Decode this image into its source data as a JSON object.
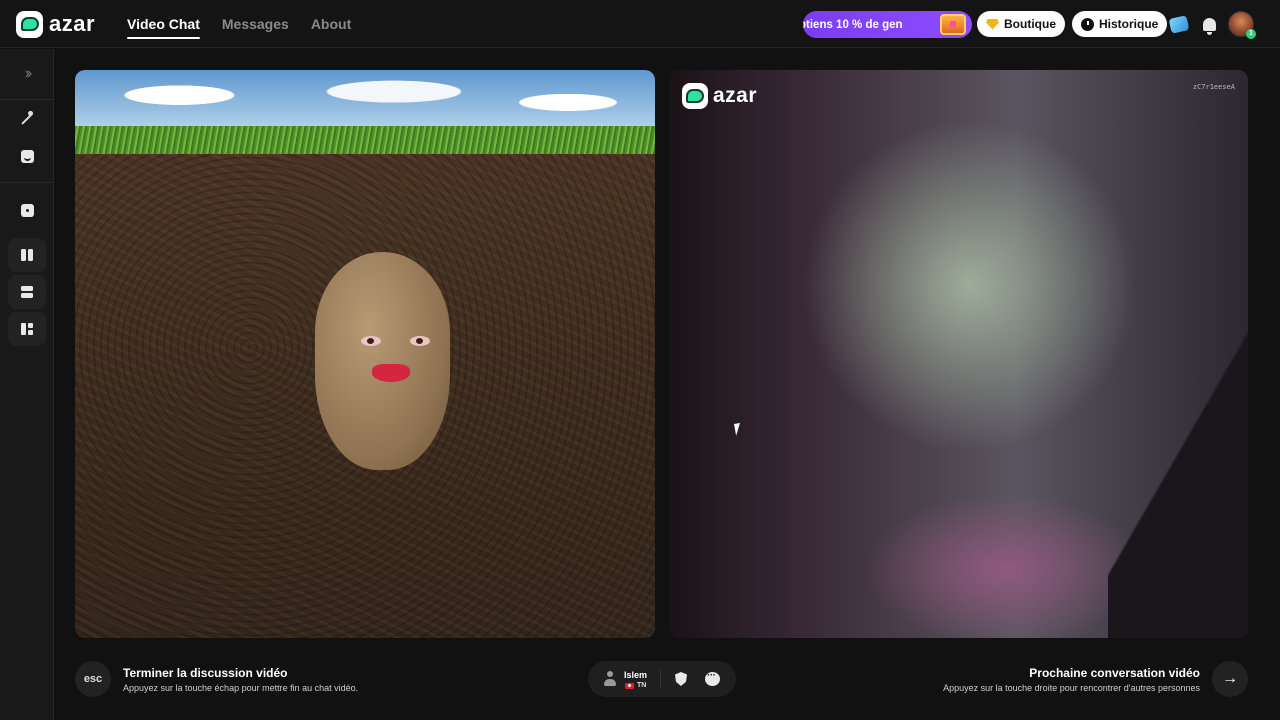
{
  "brand": {
    "name": "azar"
  },
  "nav": [
    {
      "label": "Video Chat",
      "active": true
    },
    {
      "label": "Messages",
      "active": false
    },
    {
      "label": "About",
      "active": false
    }
  ],
  "header": {
    "promo_text": "btiens 10 % de gen",
    "shop_label": "Boutique",
    "history_label": "Historique",
    "avatar_badge": "1",
    "icons": [
      "gift-icon",
      "bell-icon"
    ]
  },
  "sidebar": {
    "items": [
      "expand-icon",
      "magic-wand-icon",
      "sticker-icon",
      "dice-icon",
      "layout-side-by-side-icon",
      "layout-stacked-icon",
      "layout-grid-icon"
    ]
  },
  "remote": {
    "watermark": "azar",
    "session_id": "zC7r1eeseA"
  },
  "footer": {
    "esc_key": "esc",
    "end_title": "Terminer la discussion vidéo",
    "end_subtitle": "Appuyez sur la touche échap pour mettre fin au chat vidéo.",
    "user_name": "Islem",
    "user_country": "TN",
    "next_title": "Prochaine conversation vidéo",
    "next_subtitle": "Appuyez sur la touche droite pour rencontrer d'autres personnes",
    "next_arrow": "→"
  },
  "colors": {
    "accent_promo": "#8f4cff",
    "brand_green": "#2fe0a0",
    "background": "#111111"
  }
}
